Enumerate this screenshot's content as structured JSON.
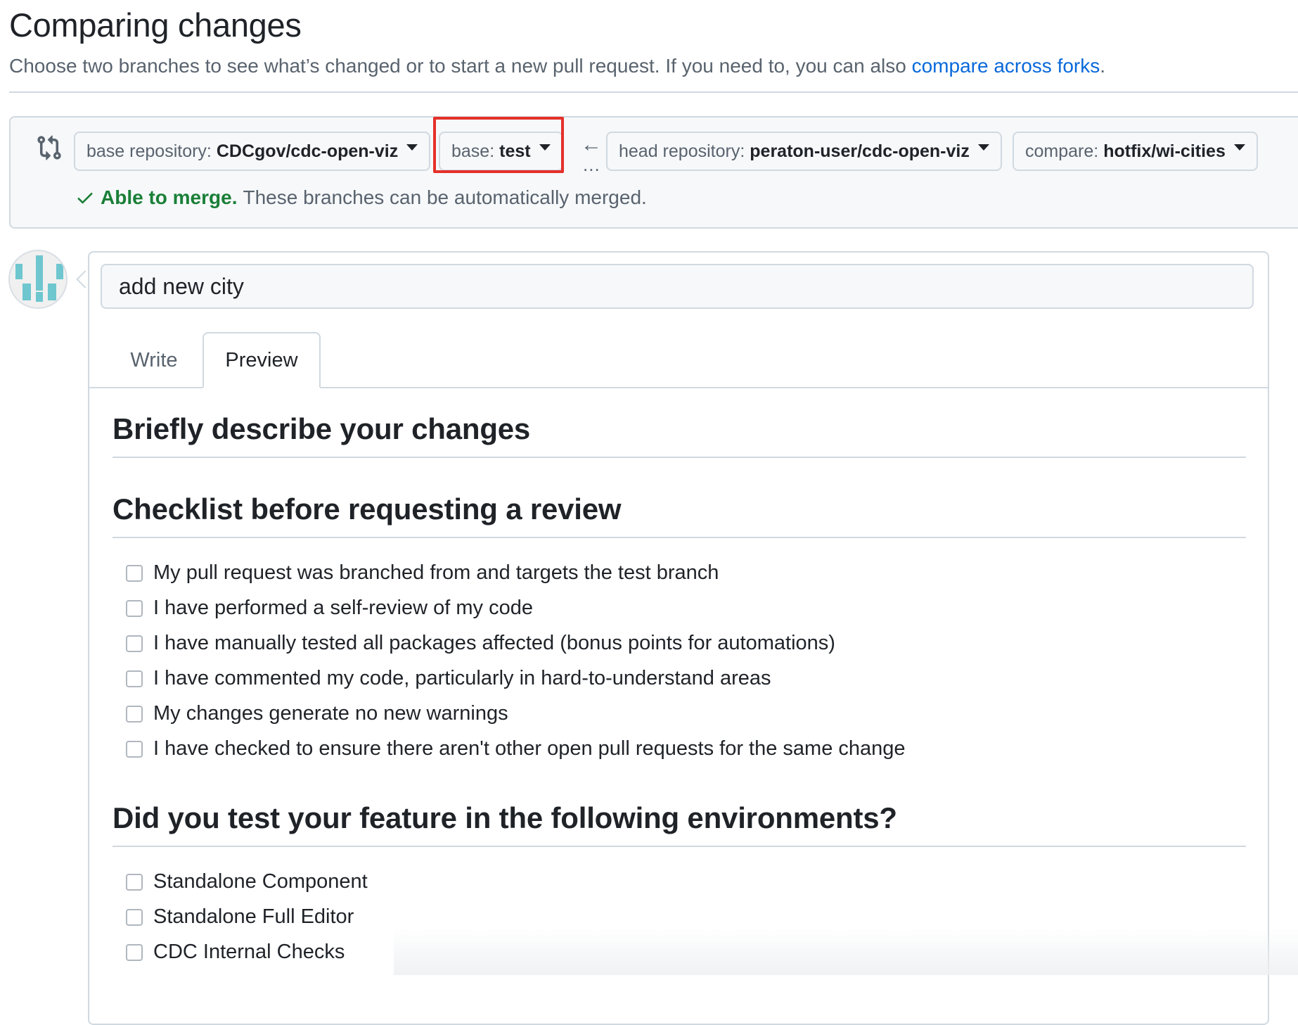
{
  "header": {
    "title": "Comparing changes",
    "subtitle": "Choose two branches to see what’s changed or to start a new pull request. If you need to, you can also ",
    "link": "compare across forks",
    "link_suffix": "."
  },
  "compare": {
    "base_repo_label": "base repository:",
    "base_repo_value": "CDCgov/cdc-open-viz",
    "base_label": "base:",
    "base_value": "test",
    "arrow": "←",
    "dots": "...",
    "head_repo_label": "head repository:",
    "head_repo_value": "peraton-user/cdc-open-viz",
    "compare_label": "compare:",
    "compare_value": "hotfix/wi-cities",
    "merge_ok": "Able to merge.",
    "merge_msg": "These branches can be automatically merged."
  },
  "composer": {
    "title_value": "add new city",
    "tabs": [
      {
        "label": "Write",
        "active": false
      },
      {
        "label": "Preview",
        "active": true
      }
    ]
  },
  "preview": {
    "heading1": "Briefly describe your changes",
    "heading2": "Checklist before requesting a review",
    "checklist": [
      "My pull request was branched from and targets the test branch",
      "I have performed a self-review of my code",
      "I have manually tested all packages affected (bonus points for automations)",
      "I have commented my code, particularly in hard-to-understand areas",
      "My changes generate no new warnings",
      "I have checked to ensure there aren't other open pull requests for the same change"
    ],
    "heading3": "Did you test your feature in the following environments?",
    "environments": [
      "Standalone Component",
      "Standalone Full Editor",
      "CDC Internal Checks"
    ]
  },
  "colors": {
    "link": "#0969da",
    "success": "#1a7f37",
    "highlight": "#e5302a",
    "avatar": "#6ec6cf"
  }
}
